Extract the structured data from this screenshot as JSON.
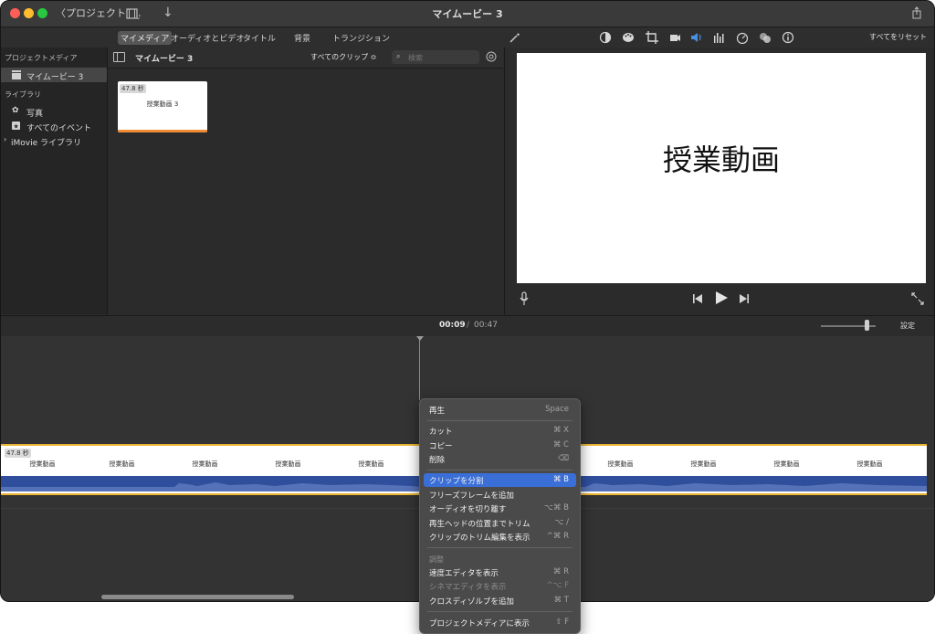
{
  "titlebar": {
    "back_label": "〈プロジェクト",
    "title": "マイムービー 3"
  },
  "toolbar": {
    "tabs": [
      {
        "label": "マイメディア",
        "active": true
      },
      {
        "label": "オーディオとビデオ",
        "active": false
      },
      {
        "label": "タイトル",
        "active": false
      },
      {
        "label": "背景",
        "active": false
      },
      {
        "label": "トランジション",
        "active": false
      }
    ],
    "reset_all": "すべてをリセット",
    "adjust_icons": [
      "color-balance-icon",
      "color-palette-icon",
      "crop-icon",
      "stabilization-icon",
      "volume-icon",
      "noise-eq-icon",
      "speed-icon",
      "filter-icon",
      "info-icon"
    ]
  },
  "sidebar": {
    "project_media_heading": "プロジェクトメディア",
    "project_item": "マイムービー 3",
    "library_heading": "ライブラリ",
    "items": [
      {
        "label": "写真"
      },
      {
        "label": "すべてのイベント"
      },
      {
        "label": "iMovie ライブラリ"
      }
    ]
  },
  "browser": {
    "title": "マイムービー 3",
    "clips_filter": "すべてのクリップ ≎",
    "search_placeholder": "検索",
    "clip": {
      "duration": "47.8 秒",
      "title": "授業動画 3"
    }
  },
  "viewer": {
    "title_text": "授業動画"
  },
  "timeline": {
    "current_time": "00:09",
    "separator": "/",
    "total_time": "00:47",
    "settings_label": "設定",
    "strip_duration": "47.8 秒",
    "frame_label": "授業動画"
  },
  "context_menu": {
    "items": [
      {
        "label": "再生",
        "shortcut": "Space"
      },
      {
        "label": "カット",
        "shortcut": "⌘ X"
      },
      {
        "label": "コピー",
        "shortcut": "⌘ C"
      },
      {
        "label": "削除",
        "shortcut": "⌫"
      },
      {
        "label": "クリップを分割",
        "shortcut": "⌘ B"
      },
      {
        "label": "フリーズフレームを追加",
        "shortcut": ""
      },
      {
        "label": "オーディオを切り離す",
        "shortcut": "⌥⌘ B"
      },
      {
        "label": "再生ヘッドの位置までトリム",
        "shortcut": "⌥ /"
      },
      {
        "label": "クリップのトリム編集を表示",
        "shortcut": "^⌘ R"
      },
      {
        "label": "調整",
        "shortcut": ""
      },
      {
        "label": "速度エディタを表示",
        "shortcut": "⌘ R"
      },
      {
        "label": "シネマエディタを表示",
        "shortcut": "^⌥ F"
      },
      {
        "label": "クロスディゾルブを追加",
        "shortcut": "⌘ T"
      },
      {
        "label": "プロジェクトメディアに表示",
        "shortcut": "⇧ F"
      }
    ]
  },
  "colors": {
    "accent_blue": "#3a6fd8",
    "clip_border": "#e8b431",
    "audio": "#2f4f9c"
  }
}
